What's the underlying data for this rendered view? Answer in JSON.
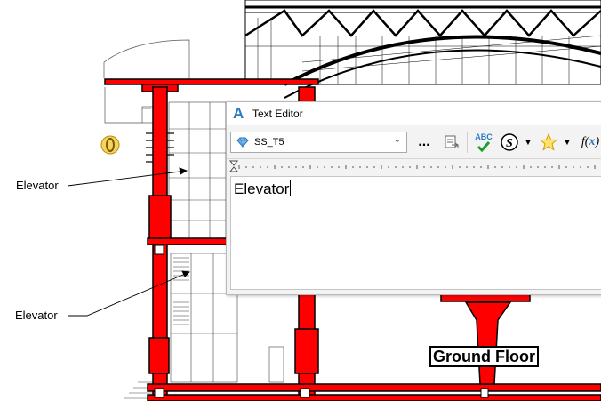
{
  "drawing": {
    "annotations": [
      {
        "label": "Elevator"
      },
      {
        "label": "Elevator"
      }
    ],
    "ground_floor_label": "Ground Floor",
    "colors": {
      "structure": "#ff0000",
      "line": "#000000",
      "background": "#ffffff"
    }
  },
  "text_editor": {
    "title_icon": "A",
    "title": "Text Editor",
    "text_style": "SS_T5",
    "more_label": "...",
    "spellcheck_label": "ABC",
    "content": "Elevator",
    "icons": [
      "text-style-gem-icon",
      "chevron-down-icon",
      "import-text-icon",
      "spellcheck-icon",
      "symbol-icon",
      "favorites-star-icon",
      "formula-icon"
    ],
    "colors": {
      "accent": "#2b79c2",
      "star": "#f2b400",
      "check": "#1a9f2b"
    }
  }
}
